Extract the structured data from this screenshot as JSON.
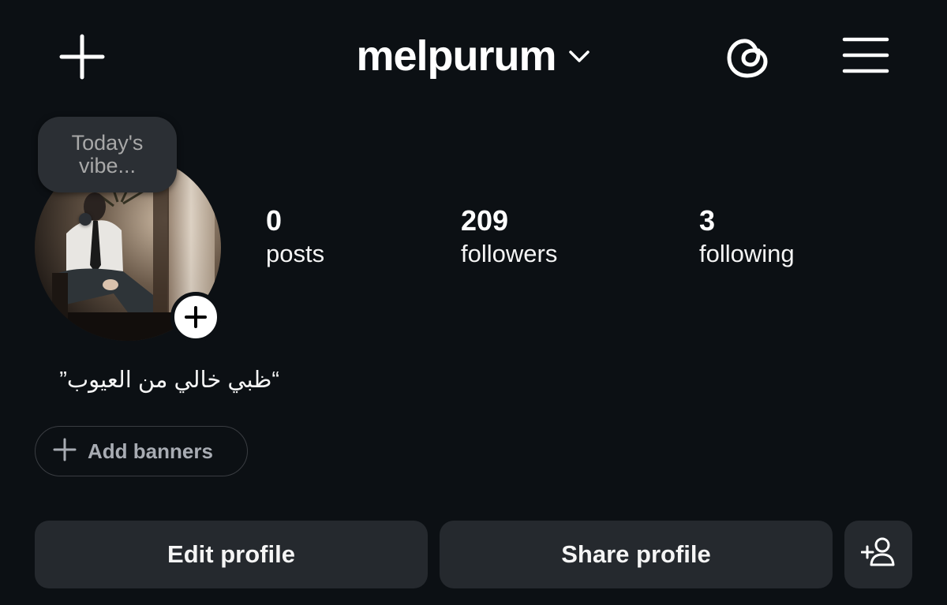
{
  "header": {
    "username": "melpurum",
    "icons": {
      "create": "plus-icon",
      "switch_account": "chevron-down-icon",
      "threads": "threads-icon",
      "menu": "hamburger-menu-icon"
    }
  },
  "profile": {
    "note": "Today's vibe...",
    "avatar_add": "plus-icon",
    "bio": "“ظبي خالي من العيوب”"
  },
  "stats": [
    {
      "value": "0",
      "label": "posts"
    },
    {
      "value": "209",
      "label": "followers"
    },
    {
      "value": "3",
      "label": "following"
    }
  ],
  "banners": {
    "label": "Add banners",
    "icon": "plus-icon"
  },
  "actions": {
    "edit_profile": "Edit profile",
    "share_profile": "Share profile",
    "discover_people_icon": "add-person-icon"
  },
  "colors": {
    "background": "#0c1014",
    "button": "#25292e",
    "note_bubble": "#2b2f34",
    "muted_text": "#a8acb3"
  }
}
